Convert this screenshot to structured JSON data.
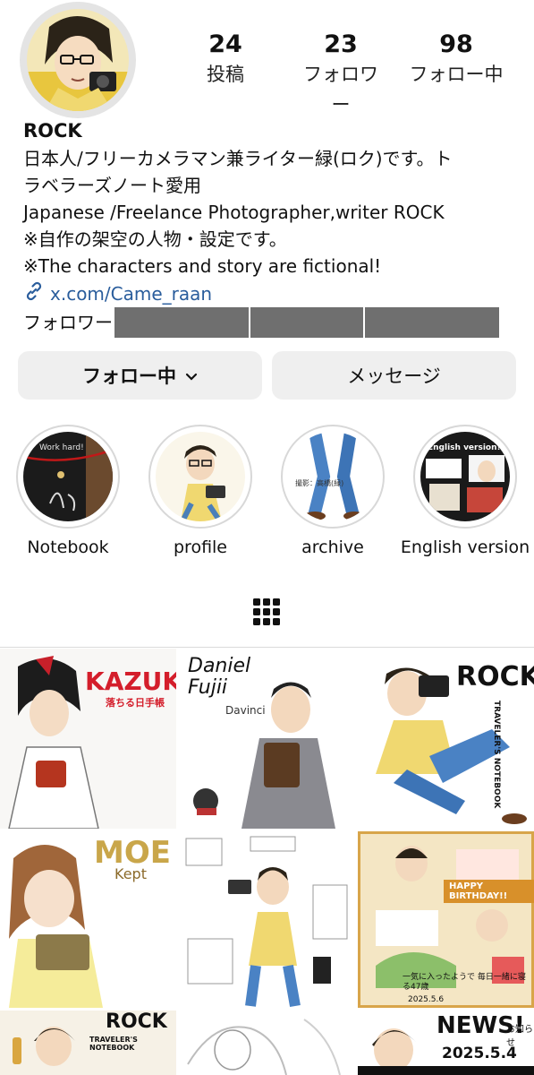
{
  "profile": {
    "username": "ROCK",
    "stats": {
      "posts": {
        "value": "24",
        "label": "投稿"
      },
      "followers": {
        "value": "23",
        "label": "フォロワー"
      },
      "following": {
        "value": "98",
        "label": "フォロー中"
      }
    },
    "bio_lines": [
      "日本人/フリーカメラマン兼ライター緑(ロク)です。ト",
      "ラベラーズノート愛用",
      "Japanese /Freelance Photographer,writer ROCK",
      "※自作の架空の人物・設定です。",
      "※The characters and story are fictional!"
    ],
    "link": "x.com/Came_raan",
    "followed_by_label": "フォロワー"
  },
  "actions": {
    "following_label": "フォロー中",
    "message_label": "メッセージ"
  },
  "highlights": [
    {
      "label": "Notebook",
      "art_text": "Work hard!"
    },
    {
      "label": "profile"
    },
    {
      "label": "archive",
      "art_text": "撮影：高橋(緑)"
    },
    {
      "label": "English version",
      "art_text": "English version!"
    }
  ],
  "posts": [
    {
      "title": "KAZUKI",
      "subtitle": "落ちる日手帳"
    },
    {
      "title": "Daniel Fujii",
      "subtitle": "Davinci"
    },
    {
      "title": "ROCK",
      "subtitle": "TRAVELER'S NOTEBOOK"
    },
    {
      "title": "MOE",
      "subtitle": "Kept"
    },
    {
      "title": ""
    },
    {
      "title": "HAPPY BIRTHDAY!!",
      "subtitle": "一気に入ったようで 毎日一緒に寝る47歳",
      "date": "2025.5.6"
    },
    {
      "title": "ROCK",
      "subtitle": "TRAVELER'S NOTEBOOK"
    },
    {
      "title": ""
    },
    {
      "title": "NEWS!",
      "subtitle": "お知らせ",
      "date": "2025.5.4"
    }
  ],
  "colors": {
    "link": "#2a5d9c",
    "button_bg": "#efefef",
    "kazuki_red": "#d41e2b",
    "moe_gold": "#c9a64a"
  },
  "icons": [
    "avatar",
    "link-chain-icon",
    "chevron-down-icon",
    "grid-icon"
  ]
}
